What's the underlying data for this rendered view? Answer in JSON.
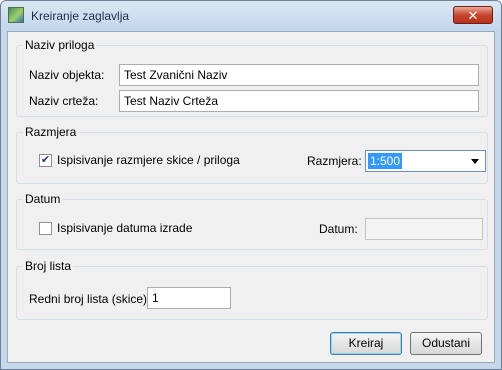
{
  "window": {
    "title": "Kreiranje zaglavlja",
    "close_label": "✕"
  },
  "naziv_priloga": {
    "title": "Naziv priloga",
    "objekt_label": "Naziv objekta:",
    "objekt_value": "Test Zvanični Naziv",
    "crtez_label": "Naziv crteža:",
    "crtez_value": "Test Naziv Crteža"
  },
  "razmjera": {
    "title": "Razmjera",
    "checkbox_label": "Ispisivanje razmjere skice / priloga",
    "checked": true,
    "select_label": "Razmjera:",
    "select_value": "1:500"
  },
  "datum": {
    "title": "Datum",
    "checkbox_label": "Ispisivanje datuma izrade",
    "checked": false,
    "field_label": "Datum:",
    "field_value": ""
  },
  "broj_lista": {
    "title": "Broj lista",
    "label": "Redni broj lista (skice):",
    "value": "1"
  },
  "buttons": {
    "create": "Kreiraj",
    "cancel": "Odustani"
  }
}
